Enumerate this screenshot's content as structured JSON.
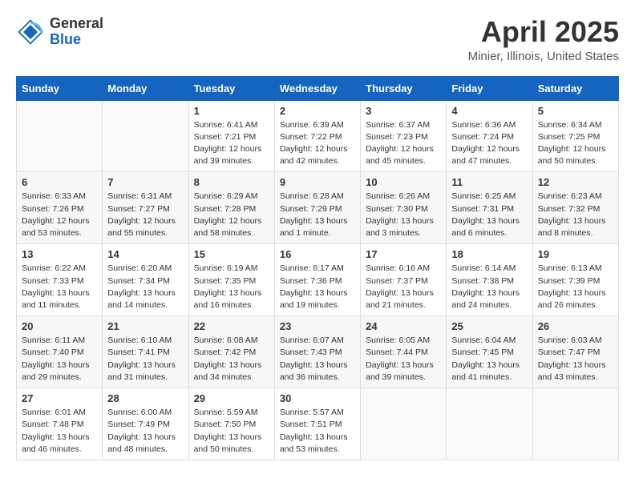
{
  "header": {
    "logo": {
      "general": "General",
      "blue": "Blue"
    },
    "title": "April 2025",
    "location": "Minier, Illinois, United States"
  },
  "weekdays": [
    "Sunday",
    "Monday",
    "Tuesday",
    "Wednesday",
    "Thursday",
    "Friday",
    "Saturday"
  ],
  "weeks": [
    [
      {
        "day": "",
        "info": ""
      },
      {
        "day": "",
        "info": ""
      },
      {
        "day": "1",
        "info": "Sunrise: 6:41 AM\nSunset: 7:21 PM\nDaylight: 12 hours\nand 39 minutes."
      },
      {
        "day": "2",
        "info": "Sunrise: 6:39 AM\nSunset: 7:22 PM\nDaylight: 12 hours\nand 42 minutes."
      },
      {
        "day": "3",
        "info": "Sunrise: 6:37 AM\nSunset: 7:23 PM\nDaylight: 12 hours\nand 45 minutes."
      },
      {
        "day": "4",
        "info": "Sunrise: 6:36 AM\nSunset: 7:24 PM\nDaylight: 12 hours\nand 47 minutes."
      },
      {
        "day": "5",
        "info": "Sunrise: 6:34 AM\nSunset: 7:25 PM\nDaylight: 12 hours\nand 50 minutes."
      }
    ],
    [
      {
        "day": "6",
        "info": "Sunrise: 6:33 AM\nSunset: 7:26 PM\nDaylight: 12 hours\nand 53 minutes."
      },
      {
        "day": "7",
        "info": "Sunrise: 6:31 AM\nSunset: 7:27 PM\nDaylight: 12 hours\nand 55 minutes."
      },
      {
        "day": "8",
        "info": "Sunrise: 6:29 AM\nSunset: 7:28 PM\nDaylight: 12 hours\nand 58 minutes."
      },
      {
        "day": "9",
        "info": "Sunrise: 6:28 AM\nSunset: 7:29 PM\nDaylight: 13 hours\nand 1 minute."
      },
      {
        "day": "10",
        "info": "Sunrise: 6:26 AM\nSunset: 7:30 PM\nDaylight: 13 hours\nand 3 minutes."
      },
      {
        "day": "11",
        "info": "Sunrise: 6:25 AM\nSunset: 7:31 PM\nDaylight: 13 hours\nand 6 minutes."
      },
      {
        "day": "12",
        "info": "Sunrise: 6:23 AM\nSunset: 7:32 PM\nDaylight: 13 hours\nand 8 minutes."
      }
    ],
    [
      {
        "day": "13",
        "info": "Sunrise: 6:22 AM\nSunset: 7:33 PM\nDaylight: 13 hours\nand 11 minutes."
      },
      {
        "day": "14",
        "info": "Sunrise: 6:20 AM\nSunset: 7:34 PM\nDaylight: 13 hours\nand 14 minutes."
      },
      {
        "day": "15",
        "info": "Sunrise: 6:19 AM\nSunset: 7:35 PM\nDaylight: 13 hours\nand 16 minutes."
      },
      {
        "day": "16",
        "info": "Sunrise: 6:17 AM\nSunset: 7:36 PM\nDaylight: 13 hours\nand 19 minutes."
      },
      {
        "day": "17",
        "info": "Sunrise: 6:16 AM\nSunset: 7:37 PM\nDaylight: 13 hours\nand 21 minutes."
      },
      {
        "day": "18",
        "info": "Sunrise: 6:14 AM\nSunset: 7:38 PM\nDaylight: 13 hours\nand 24 minutes."
      },
      {
        "day": "19",
        "info": "Sunrise: 6:13 AM\nSunset: 7:39 PM\nDaylight: 13 hours\nand 26 minutes."
      }
    ],
    [
      {
        "day": "20",
        "info": "Sunrise: 6:11 AM\nSunset: 7:40 PM\nDaylight: 13 hours\nand 29 minutes."
      },
      {
        "day": "21",
        "info": "Sunrise: 6:10 AM\nSunset: 7:41 PM\nDaylight: 13 hours\nand 31 minutes."
      },
      {
        "day": "22",
        "info": "Sunrise: 6:08 AM\nSunset: 7:42 PM\nDaylight: 13 hours\nand 34 minutes."
      },
      {
        "day": "23",
        "info": "Sunrise: 6:07 AM\nSunset: 7:43 PM\nDaylight: 13 hours\nand 36 minutes."
      },
      {
        "day": "24",
        "info": "Sunrise: 6:05 AM\nSunset: 7:44 PM\nDaylight: 13 hours\nand 39 minutes."
      },
      {
        "day": "25",
        "info": "Sunrise: 6:04 AM\nSunset: 7:45 PM\nDaylight: 13 hours\nand 41 minutes."
      },
      {
        "day": "26",
        "info": "Sunrise: 6:03 AM\nSunset: 7:47 PM\nDaylight: 13 hours\nand 43 minutes."
      }
    ],
    [
      {
        "day": "27",
        "info": "Sunrise: 6:01 AM\nSunset: 7:48 PM\nDaylight: 13 hours\nand 46 minutes."
      },
      {
        "day": "28",
        "info": "Sunrise: 6:00 AM\nSunset: 7:49 PM\nDaylight: 13 hours\nand 48 minutes."
      },
      {
        "day": "29",
        "info": "Sunrise: 5:59 AM\nSunset: 7:50 PM\nDaylight: 13 hours\nand 50 minutes."
      },
      {
        "day": "30",
        "info": "Sunrise: 5:57 AM\nSunset: 7:51 PM\nDaylight: 13 hours\nand 53 minutes."
      },
      {
        "day": "",
        "info": ""
      },
      {
        "day": "",
        "info": ""
      },
      {
        "day": "",
        "info": ""
      }
    ]
  ]
}
